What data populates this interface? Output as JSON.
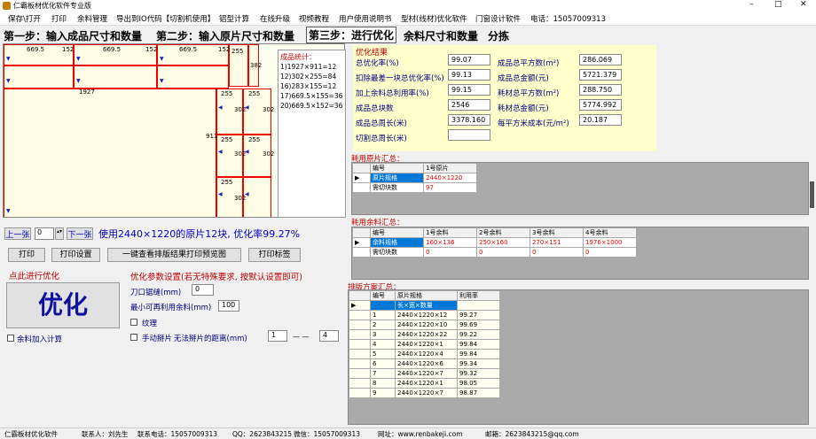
{
  "window": {
    "title": "仁霸板材优化软件专业版",
    "min": "–",
    "max": "□",
    "close": "✕"
  },
  "menu": [
    "保存\\打开",
    "打印",
    "余料管理",
    "导出到IO代码【切割机使用】",
    "铝型计算",
    "在线升级",
    "视频教程",
    "用户使用说明书",
    "型材(线材)优化软件",
    "门窗设计软件",
    "电话：15057009313"
  ],
  "steps": {
    "s1": "第一步：输入成品尺寸和数量",
    "s2": "第二步：输入原片尺寸和数量",
    "s3": "第三步：进行优化",
    "s4": "余料尺寸和数量",
    "s5": "分拣"
  },
  "canvas": {
    "labels": {
      "a": "669.5",
      "b": "152",
      "c": "669.5",
      "d": "152",
      "e": "669.5",
      "f": "152",
      "g": "255",
      "h": "382",
      "i": "1927",
      "j": "911",
      "k": "255",
      "l": "302",
      "m": "255",
      "n": "302",
      "o": "255",
      "p": "302",
      "q": "255",
      "r": "302",
      "s": "255",
      "t": "302"
    }
  },
  "stats": {
    "title": "成品统计：",
    "lines": [
      "1)1927×911=12",
      "12)302×255=84",
      "16)283×155=12",
      "17)669.5×155=36",
      "20)669.5×152=36"
    ]
  },
  "nav": {
    "prev": "上一张",
    "page": "0",
    "next": "下一张",
    "summary": "使用2440×1220的原片12块, 优化率99.27%"
  },
  "buttons": {
    "print": "打印",
    "print_setup": "打印设置",
    "preview": "一键查看排版结果打印预览图",
    "print_label": "打印标签"
  },
  "optimize": {
    "label": "点此进行优化",
    "button": "优化",
    "leftover_calc": "余料加入计算"
  },
  "params": {
    "title": "优化参数设置(若无特殊要求, 按默认设置即可)",
    "kerf_label": "刀口锯缝(mm)",
    "kerf": "0",
    "min_label": "最小可再利用余料(mm)",
    "min": "100",
    "texture": "纹理",
    "manual": "手动掰片",
    "manual_dist": "无法掰片的距离(mm)",
    "from": "1",
    "to": "4",
    "dash": "— —"
  },
  "result": {
    "title": "优化结果",
    "rate_l": "总优化率(%)",
    "rate": "99.07",
    "area_l": "成品总平方数(m²)",
    "area": "286.069",
    "last_l": "扣除最差一块总优化率(%)",
    "last": "99.13",
    "amount_l": "成品总金额(元)",
    "amount": "5721.379",
    "add_l": "加上余料总利用率(%)",
    "add": "99.15",
    "consume_l": "耗材总平方数(m²)",
    "consume": "288.750",
    "count_l": "成品总块数",
    "count": "2546",
    "consume_amt_l": "耗材总金额(元)",
    "consume_amt": "5774.992",
    "perim_l": "成品总周长(米)",
    "perim": "3378.160",
    "unit_cost_l": "每平方米成本(元/m²)",
    "unit_cost": "20.187",
    "cut_l": "切割总周长(米)",
    "cut": ""
  },
  "orig": {
    "title": "耗用原片汇总：",
    "h0": "编号",
    "h1": "1号原片",
    "r1": "原片规格",
    "v1": "2440×1220",
    "r2": "需切块数",
    "v2": "97"
  },
  "left": {
    "title": "耗用余料汇总：",
    "h": [
      "编号",
      "1号余料",
      "2号余料",
      "3号余料",
      "4号余料"
    ],
    "r1": "余料规格",
    "v1": [
      "160×136",
      "250×160",
      "270×151",
      "1976×1000"
    ],
    "r2": "需切块数",
    "v2": [
      "0",
      "0",
      "0",
      "0"
    ]
  },
  "plan": {
    "title": "排版方案汇总：",
    "h": [
      "编号",
      "原片规格",
      "利用率"
    ],
    "first": "长×宽×数量",
    "rows": [
      [
        "1",
        "2440×1220×12",
        "99.27"
      ],
      [
        "2",
        "2440×1220×10",
        "99.69"
      ],
      [
        "3",
        "2440×1220×22",
        "99.22"
      ],
      [
        "4",
        "2440×1220×1",
        "99.84"
      ],
      [
        "5",
        "2440×1220×4",
        "99.84"
      ],
      [
        "6",
        "2440×1220×6",
        "99.34"
      ],
      [
        "7",
        "2440×1220×7",
        "99.32"
      ],
      [
        "8",
        "2440×1220×1",
        "98.05"
      ],
      [
        "9",
        "2440×1220×7",
        "98.87"
      ]
    ]
  },
  "status": {
    "app": "仁霸板材优化软件",
    "contact": "联系人：刘先生",
    "phone": "联系电话：15057009313",
    "qq": "QQ：2623843215",
    "wx": "微信：15057009313",
    "web": "网址：www.renbakeji.com",
    "mail": "邮箱：2623843215@qq.com"
  }
}
